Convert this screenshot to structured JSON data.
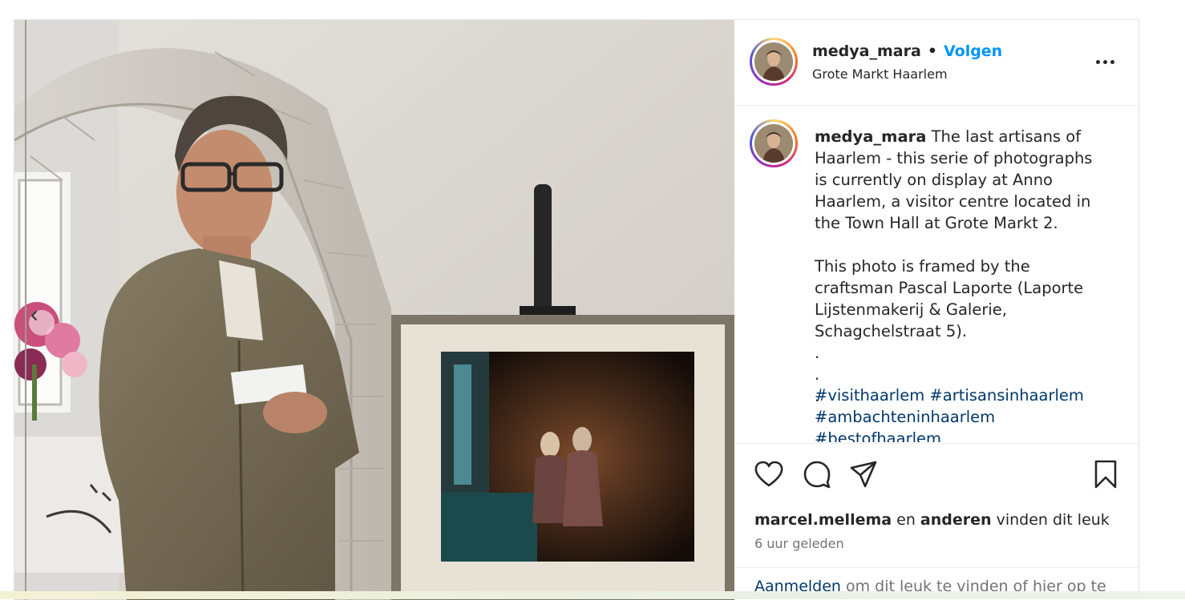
{
  "post": {
    "username": "medya_mara",
    "separator": "•",
    "follow_label": "Volgen",
    "location": "Grote Markt Haarlem",
    "caption_username": "medya_mara",
    "caption_text": " The last artisans of Haarlem - this serie of photographs is currently on display at Anno Haarlem, a visitor centre located in the Town Hall at Grote Markt 2.\n\nThis photo is framed by the craftsman Pascal Laporte (Laporte Lijstenmakerij & Galerie, Schagchelstraat 5).\n.\n.\n.",
    "hashtags": [
      "#visithaarlem",
      "#artisansinhaarlem",
      "#ambachteninhaarlem",
      "#bestofhaarlem"
    ],
    "liked_by_user": "marcel.mellema",
    "likes_connector": " en ",
    "liked_by_others": "anderen",
    "likes_suffix": " vinden dit leuk",
    "time_ago": "6 uur geleden",
    "login_link": "Aanmelden",
    "login_text": " om dit leuk te vinden of hier op te"
  },
  "icons": {
    "more": "more-options-icon",
    "like": "heart-icon",
    "comment": "comment-icon",
    "share": "paper-plane-icon",
    "save": "bookmark-icon",
    "carousel_prev": "chevron-left-icon"
  },
  "colors": {
    "follow": "#0095f6",
    "hashtag": "#00376b",
    "muted": "#737373",
    "text": "#262626"
  }
}
